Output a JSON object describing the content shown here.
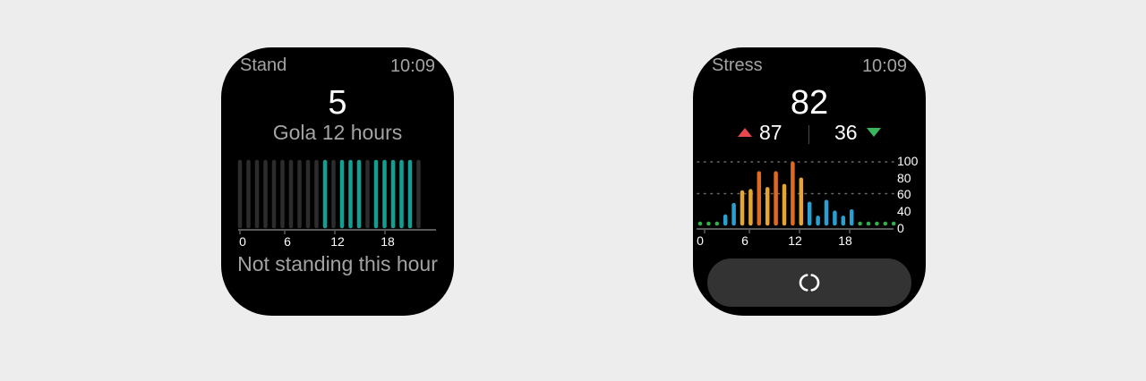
{
  "stand": {
    "title": "Stand",
    "time": "10:09",
    "value": "5",
    "goal": "Gola 12 hours",
    "status": "Not standing this hour",
    "hours_stood": [
      0,
      0,
      0,
      0,
      0,
      0,
      0,
      0,
      0,
      0,
      1,
      0,
      1,
      1,
      1,
      0,
      1,
      1,
      1,
      1,
      1,
      0
    ],
    "x_ticks": [
      "0",
      "6",
      "12",
      "18"
    ],
    "colors": {
      "active": "#129e91",
      "inactive": "#2c2c2c"
    }
  },
  "stress": {
    "title": "Stress",
    "time": "10:09",
    "value": "82",
    "max": "87",
    "min": "36",
    "refresh_icon": "refresh-icon",
    "colors": {
      "up": "#e8484c",
      "down": "#3bb65c"
    }
  },
  "chart_data": {
    "type": "bar",
    "x": [
      0,
      1,
      2,
      3,
      4,
      5,
      6,
      7,
      8,
      9,
      10,
      11,
      12,
      13,
      14,
      15,
      16,
      17,
      18,
      19,
      20,
      21,
      22,
      23
    ],
    "values": [
      5,
      5,
      5,
      17,
      35,
      55,
      57,
      85,
      60,
      85,
      65,
      100,
      75,
      37,
      15,
      40,
      23,
      15,
      25,
      5,
      5,
      5,
      5,
      5
    ],
    "x_ticks": [
      "0",
      "6",
      "12",
      "18"
    ],
    "y_ticks": [
      "100",
      "80",
      "60",
      "40",
      "0"
    ],
    "ylim": [
      0,
      100
    ],
    "colors": {
      "relaxed": "#2db34a",
      "normal": "#2a9fd0",
      "medium": "#e4a531",
      "high": "#e06a22"
    }
  }
}
